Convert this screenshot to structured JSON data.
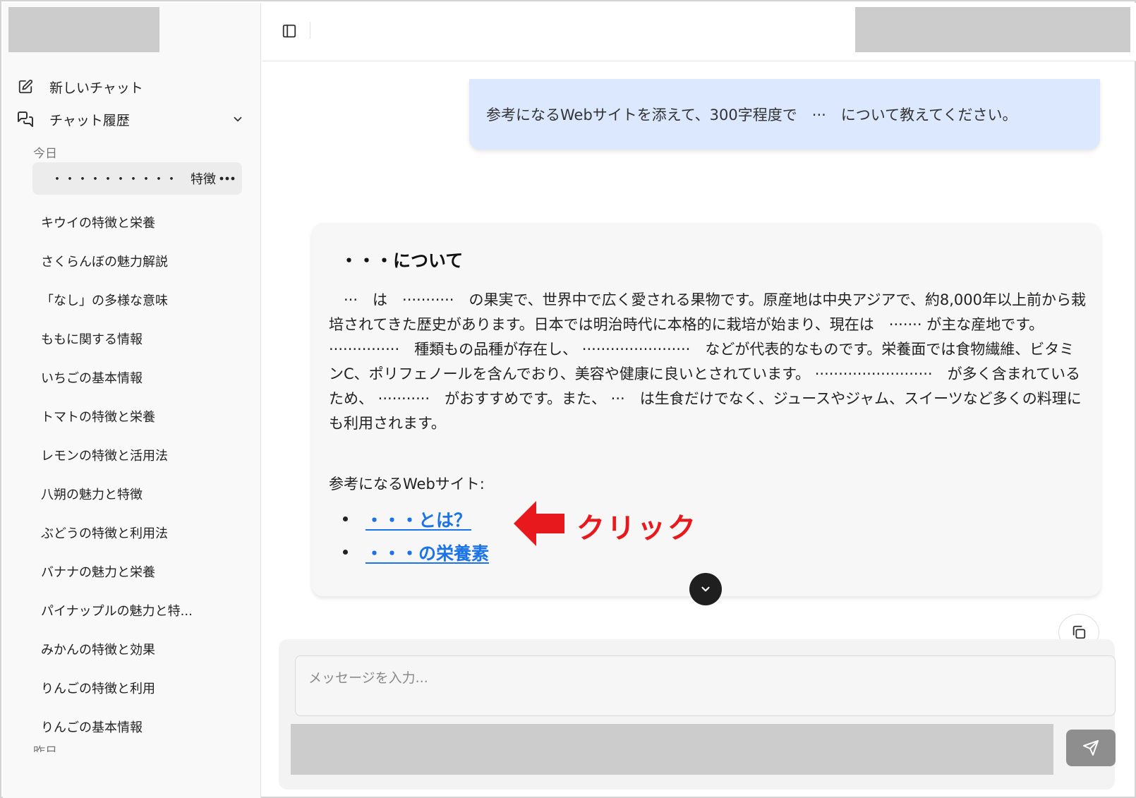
{
  "sidebar": {
    "new_chat_label": "新しいチャット",
    "history_label": "チャット履歴",
    "group_today": "今日",
    "group_yesterday": "昨日",
    "active_item": "・・・・・・・・・・　特徴",
    "items": [
      "キウイの特徴と栄養",
      "さくらんぼの魅力解説",
      "「なし」の多様な意味",
      "ももに関する情報",
      "いちごの基本情報",
      "トマトの特徴と栄養",
      "レモンの特徴と活用法",
      "八朔の魅力と特徴",
      "ぶどうの特徴と利用法",
      "バナナの魅力と栄養",
      "パイナップルの魅力と特...",
      "みかんの特徴と効果",
      "りんごの特徴と利用",
      "りんごの基本情報"
    ]
  },
  "chat": {
    "user_message": "参考になるWebサイトを添えて、300字程度で　···　について教えてください。",
    "ai_title": "・・・について",
    "ai_body": "　···　は　···········　の果実で、世界中で広く愛される果物です。原産地は中央アジアで、約8,000年以上前から栽培されてきた歴史があります。日本では明治時代に本格的に栽培が始まり、現在は　······· が主な産地です。 ···············　種類もの品種が存在し、 ·······················　などが代表的なものです。栄養面では食物繊維、ビタミンC、ポリフェノールを含んでおり、美容や健康に良いとされています。 ·························　が多く含まれているため、 ···········　がおすすめです。また、 ···　は生食だけでなく、ジュースやジャム、スイーツなど多くの料理にも利用されます。",
    "ref_label": "参考になるWebサイト:",
    "links": [
      "・・・とは？",
      "・・・の栄養素"
    ]
  },
  "annotation": {
    "text": "クリック",
    "color": "#e8191c"
  },
  "composer": {
    "placeholder": "メッセージを入力..."
  },
  "colors": {
    "accent_link": "#1a73e8",
    "user_bubble": "#dbe8fd",
    "placeholder_block": "#cccccc"
  }
}
